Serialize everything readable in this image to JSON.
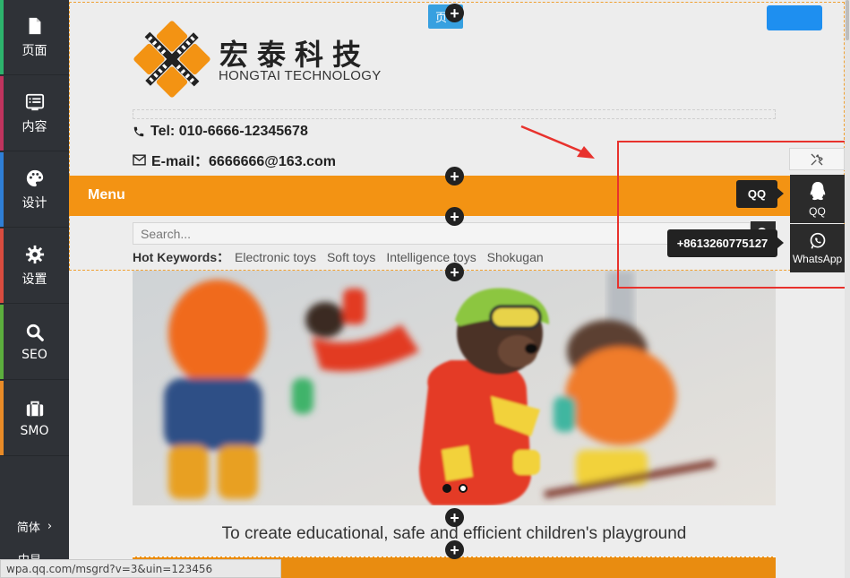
{
  "sidebar": {
    "items": [
      {
        "label": "页面",
        "icon": "file-icon",
        "accent": "#2db36c"
      },
      {
        "label": "内容",
        "icon": "list-icon",
        "accent": "#c0345e"
      },
      {
        "label": "设计",
        "icon": "palette-icon",
        "accent": "#2f7fd6"
      },
      {
        "label": "设置",
        "icon": "gear-icon",
        "accent": "#d94c3f"
      },
      {
        "label": "SEO",
        "icon": "search-icon",
        "accent": "#5cae3d"
      },
      {
        "label": "SMO",
        "icon": "briefcase-icon",
        "accent": "#e98b27"
      }
    ],
    "language": "简体",
    "language_next": "中显"
  },
  "editor": {
    "top_tag": "页",
    "add_icon": "plus-icon"
  },
  "site": {
    "logo_cn": "宏泰科技",
    "logo_en": "HONGTAI TECHNOLOGY",
    "tel": "Tel: 010-6666-12345678",
    "email": "E-mail：6666666@163.com",
    "menu_label": "Menu",
    "search_placeholder": "Search...",
    "hot_keywords_title": "Hot Keywords：",
    "hot_keywords": [
      "Electronic toys",
      "Soft toys",
      "Intelligence toys",
      "Shokugan"
    ],
    "slogan": "To create educational, safe and efficient children's playground",
    "brand_color": "#f39313"
  },
  "float_contact": {
    "tools_icon": "tools-icon",
    "qq_label": "QQ",
    "qq_tip": "QQ",
    "whatsapp_label": "WhatsApp",
    "whatsapp_tip": "+8613260775127"
  },
  "status_url": "wpa.qq.com/msgrd?v=3&uin=123456"
}
